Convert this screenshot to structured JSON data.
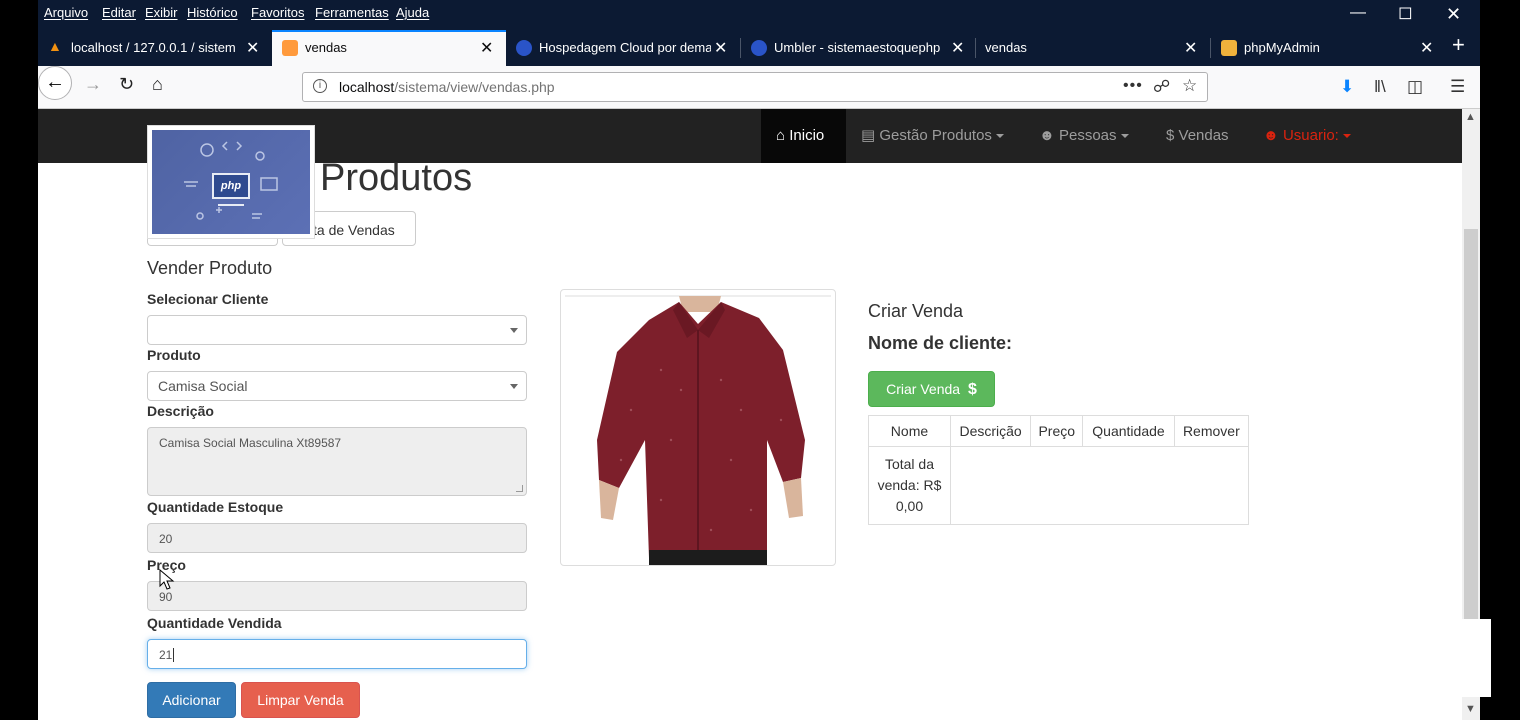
{
  "browser": {
    "menu": [
      "Arquivo",
      "Editar",
      "Exibir",
      "Histórico",
      "Favoritos",
      "Ferramentas",
      "Ajuda"
    ],
    "tabs": [
      {
        "title": "localhost / 127.0.0.1 / sistema",
        "icon": "phpmyadmin-icon"
      },
      {
        "title": "vendas",
        "icon": "page-icon",
        "active": true
      },
      {
        "title": "Hospedagem Cloud por dema",
        "icon": "umbler-icon"
      },
      {
        "title": "Umbler - sistemaestoquephp",
        "icon": "umbler-icon"
      },
      {
        "title": "vendas",
        "icon": ""
      },
      {
        "title": "phpMyAdmin",
        "icon": "phpmyadmin-icon"
      }
    ],
    "url": {
      "host": "localhost",
      "path": "/sistema/view/vendas.php"
    },
    "colors": {
      "chrome_bg": "#0c1a33",
      "active_tab_accent": "#0a84ff"
    }
  },
  "site_nav": {
    "items": [
      {
        "label": "Inicio",
        "icon": "home-icon"
      },
      {
        "label": "Gestão Produtos",
        "icon": "list-icon"
      },
      {
        "label": "Pessoas",
        "icon": "user-icon"
      },
      {
        "label": "Vendas",
        "icon": "dollar-icon"
      },
      {
        "label": "Usuario:",
        "icon": "user-icon"
      }
    ]
  },
  "page": {
    "heading": "Produtos",
    "lista_vendas_button": "ta de Vendas",
    "logo_text": "php"
  },
  "form": {
    "title": "Vender Produto",
    "cliente_label": "Selecionar Cliente",
    "cliente_value": "",
    "produto_label": "Produto",
    "produto_value": "Camisa Social",
    "descricao_label": "Descrição",
    "descricao_value": "Camisa Social Masculina Xt89587",
    "estoque_label": "Quantidade Estoque",
    "estoque_value": "20",
    "preco_label": "Preço",
    "preco_value": "90",
    "vendida_label": "Quantidade Vendida",
    "vendida_value": "21",
    "adicionar_button": "Adicionar",
    "limpar_button": "Limpar Venda"
  },
  "sale": {
    "title": "Criar Venda",
    "client_name_label": "Nome de cliente:",
    "create_button": "Criar Venda",
    "create_button_icon": "$",
    "columns": [
      "Nome",
      "Descrição",
      "Preço",
      "Quantidade",
      "Remover"
    ],
    "total_line1": "Total da",
    "total_line2": "venda: R$",
    "total_line3": "0,00"
  }
}
